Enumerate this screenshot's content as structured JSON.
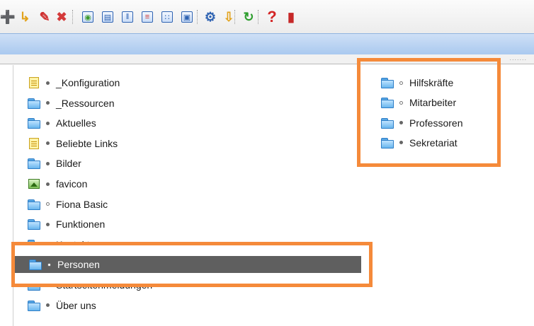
{
  "toolbar": {
    "buttons": [
      {
        "name": "new-document-icon",
        "glyph": "➕",
        "color": "#e2a21b"
      },
      {
        "name": "copy-icon",
        "glyph": "↳",
        "color": "#e2a21b"
      },
      {
        "name": "edit-icon",
        "glyph": "✎",
        "color": "#cf2f2f"
      },
      {
        "name": "delete-icon",
        "glyph": "✖",
        "color": "#d43a3a"
      },
      {
        "name": "preview-icon",
        "glyph": "◉",
        "color": "#3f9b2e"
      },
      {
        "name": "structure-icon",
        "glyph": "▤",
        "color": "#2f63b2"
      },
      {
        "name": "columns-icon",
        "glyph": "‖",
        "color": "#2f63b2"
      },
      {
        "name": "list-view-icon",
        "glyph": "≡",
        "color": "#d0342c"
      },
      {
        "name": "grid-view-icon",
        "glyph": "∷",
        "color": "#2f63b2"
      },
      {
        "name": "details-view-icon",
        "glyph": "▣",
        "color": "#2f63b2"
      },
      {
        "name": "settings-icon",
        "glyph": "⚙",
        "color": "#2f63b2"
      },
      {
        "name": "export-icon",
        "glyph": "⇩",
        "color": "#e2a21b"
      },
      {
        "name": "refresh-icon",
        "glyph": "↻",
        "color": "#2e9e2e"
      },
      {
        "name": "help-icon",
        "glyph": "?",
        "color": "#d42525"
      },
      {
        "name": "exit-icon",
        "glyph": "▮",
        "color": "#c62828"
      }
    ]
  },
  "left_tree": {
    "items": [
      {
        "icon": "doc",
        "label": "_Konfiguration"
      },
      {
        "icon": "folder",
        "label": "_Ressourcen"
      },
      {
        "icon": "folder",
        "label": "Aktuelles"
      },
      {
        "icon": "doc",
        "label": "Beliebte Links"
      },
      {
        "icon": "folder",
        "label": "Bilder"
      },
      {
        "icon": "img",
        "label": "favicon"
      },
      {
        "icon": "folder",
        "label": "Fiona Basic"
      },
      {
        "icon": "folder",
        "label": "Funktionen"
      },
      {
        "icon": "folder",
        "label": "Kontakt"
      },
      {
        "icon": "folder",
        "label": "Personen",
        "selected": true
      },
      {
        "icon": "folder",
        "label": "Startseitenmeldungen"
      },
      {
        "icon": "folder",
        "label": "Über uns"
      }
    ]
  },
  "right_tree": {
    "items": [
      {
        "icon": "folder",
        "label": "Hilfskräfte"
      },
      {
        "icon": "folder",
        "label": "Mitarbeiter"
      },
      {
        "icon": "folder",
        "label": "Professoren"
      },
      {
        "icon": "folder",
        "label": "Sekretariat"
      }
    ]
  },
  "colors": {
    "highlight": "#f58a3a",
    "selection": "#5f5f5f",
    "accent_bar": "#a8c8ef"
  }
}
